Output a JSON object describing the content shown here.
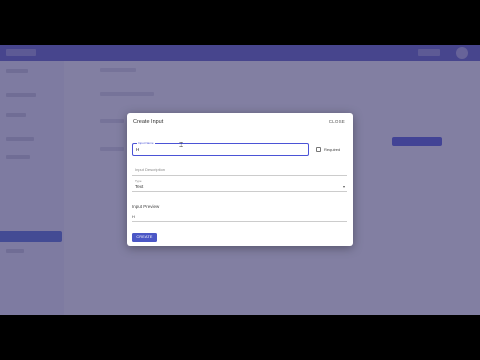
{
  "modal": {
    "title": "Create Input",
    "close_label": "CLOSE",
    "name_field": {
      "label": "Input Name",
      "value": "H"
    },
    "required_label": "Required",
    "description_placeholder": "Input Description",
    "type_field": {
      "label": "Type",
      "value": "Text"
    },
    "preview_label": "Input Preview",
    "preview_value": "H",
    "create_label": "CREATE"
  },
  "colors": {
    "accent": "#4b53d6",
    "overlay": "#3c366e",
    "sidebar_active": "#4f6fd1"
  },
  "icons": {
    "chevron": "chevron-down-icon",
    "text_cursor": "text-cursor-icon"
  }
}
